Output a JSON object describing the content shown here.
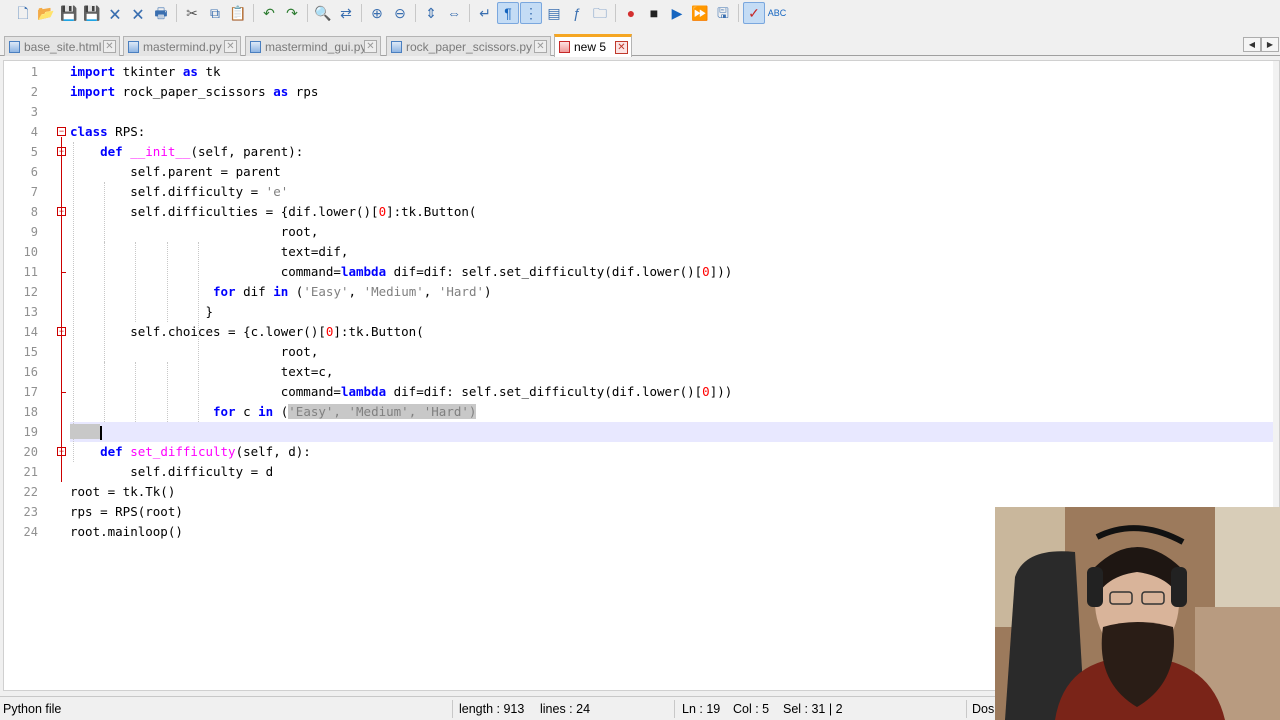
{
  "toolbar": {
    "icons": [
      "new-file",
      "open-file",
      "save",
      "save-all",
      "close",
      "close-all",
      "print",
      "cut",
      "copy",
      "paste",
      "undo",
      "redo",
      "find",
      "replace",
      "zoom-in",
      "zoom-out",
      "sync-vertical",
      "sync-horizontal",
      "word-wrap",
      "show-all-chars",
      "indent-guide",
      "doc-map",
      "function-list",
      "folder-workspace",
      "record-macro",
      "stop-record",
      "playback-macro",
      "run-macro-multiple",
      "save-macro",
      "spell-check",
      "abc"
    ]
  },
  "tabs": [
    {
      "label": "base_site.html",
      "active": false
    },
    {
      "label": "mastermind.py",
      "active": false
    },
    {
      "label": "mastermind_gui.py",
      "active": false
    },
    {
      "label": "rock_paper_scissors.py",
      "active": false
    },
    {
      "label": "new 5",
      "active": true
    }
  ],
  "editor": {
    "current_line": 19,
    "line_numbers": [
      "1",
      "2",
      "3",
      "4",
      "5",
      "6",
      "7",
      "8",
      "9",
      "10",
      "11",
      "12",
      "13",
      "14",
      "15",
      "16",
      "17",
      "18",
      "19",
      "20",
      "21",
      "22",
      "23",
      "24"
    ],
    "lines": [
      [
        [
          "kw",
          "import"
        ],
        [
          "t",
          " tkinter "
        ],
        [
          "kw",
          "as"
        ],
        [
          "t",
          " tk"
        ]
      ],
      [
        [
          "kw",
          "import"
        ],
        [
          "t",
          " rock_paper_scissors "
        ],
        [
          "kw",
          "as"
        ],
        [
          "t",
          " rps"
        ]
      ],
      [],
      [
        [
          "kw",
          "class"
        ],
        [
          "t",
          " RPS:"
        ]
      ],
      [
        [
          "t",
          "    "
        ],
        [
          "kw",
          "def"
        ],
        [
          "t",
          " "
        ],
        [
          "fn",
          "__init__"
        ],
        [
          "t",
          "(self, parent):"
        ]
      ],
      [
        [
          "t",
          "        self.parent = parent"
        ]
      ],
      [
        [
          "t",
          "        self.difficulty = "
        ],
        [
          "str",
          "'e'"
        ]
      ],
      [
        [
          "t",
          "        self.difficulties = {dif.lower()["
        ],
        [
          "num",
          "0"
        ],
        [
          "t",
          "]:tk.Button("
        ]
      ],
      [
        [
          "t",
          "                            root,"
        ]
      ],
      [
        [
          "t",
          "                            text=dif,"
        ]
      ],
      [
        [
          "t",
          "                            command="
        ],
        [
          "kw",
          "lambda"
        ],
        [
          "t",
          " dif=dif: self.set_difficulty(dif.lower()["
        ],
        [
          "num",
          "0"
        ],
        [
          "t",
          "]))"
        ]
      ],
      [
        [
          "t",
          "                   "
        ],
        [
          "kw",
          "for"
        ],
        [
          "t",
          " dif "
        ],
        [
          "kw",
          "in"
        ],
        [
          "t",
          " ("
        ],
        [
          "str",
          "'Easy'"
        ],
        [
          "t",
          ", "
        ],
        [
          "str",
          "'Medium'"
        ],
        [
          "t",
          ", "
        ],
        [
          "str",
          "'Hard'"
        ],
        [
          "t",
          ")"
        ]
      ],
      [
        [
          "t",
          "                  }"
        ]
      ],
      [
        [
          "t",
          "        self.choices = {c.lower()["
        ],
        [
          "num",
          "0"
        ],
        [
          "t",
          "]:tk.Button("
        ]
      ],
      [
        [
          "t",
          "                            root,"
        ]
      ],
      [
        [
          "t",
          "                            text=c,"
        ]
      ],
      [
        [
          "t",
          "                            command="
        ],
        [
          "kw",
          "lambda"
        ],
        [
          "t",
          " dif=dif: self.set_difficulty(dif.lower()["
        ],
        [
          "num",
          "0"
        ],
        [
          "t",
          "]))"
        ]
      ],
      [
        [
          "t",
          "                   "
        ],
        [
          "kw",
          "for"
        ],
        [
          "t",
          " c "
        ],
        [
          "kw",
          "in"
        ],
        [
          "t",
          " ("
        ],
        [
          "sel",
          "'Easy', 'Medium', 'Hard')"
        ]
      ],
      [
        [
          "sel",
          "    "
        ],
        [
          "caret",
          ""
        ]
      ],
      [
        [
          "t",
          "    "
        ],
        [
          "kw",
          "def"
        ],
        [
          "t",
          " "
        ],
        [
          "fn",
          "set_difficulty"
        ],
        [
          "t",
          "(self, d):"
        ]
      ],
      [
        [
          "t",
          "        self.difficulty = d"
        ]
      ],
      [
        [
          "t",
          "root = tk.Tk()"
        ]
      ],
      [
        [
          "t",
          "rps = RPS(root)"
        ]
      ],
      [
        [
          "t",
          "root.mainloop()"
        ]
      ]
    ]
  },
  "status": {
    "file_type": "Python file",
    "length": "length : 913",
    "lines": "lines : 24",
    "ln": "Ln : 19",
    "col": "Col : 5",
    "sel": "Sel : 31 | 2",
    "eol": "Dos"
  }
}
